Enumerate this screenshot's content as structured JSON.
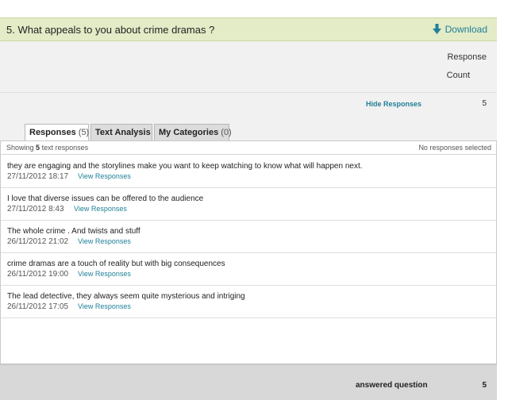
{
  "question": {
    "title": "5. What appeals to you about crime dramas ?",
    "download_label": "Download"
  },
  "response_count_header": {
    "line1": "Response",
    "line2": "Count"
  },
  "hide_responses": {
    "label": "Hide Responses",
    "count": "5"
  },
  "tabs": [
    {
      "label": "Responses",
      "count": "(5)",
      "active": true
    },
    {
      "label": "Text Analysis",
      "count": "",
      "active": false
    },
    {
      "label": "My Categories",
      "count": "(0)",
      "active": false
    }
  ],
  "toolbar": {
    "showing_prefix": "Showing",
    "showing_count": "5",
    "showing_suffix": "text responses",
    "selection_status": "No responses selected"
  },
  "responses": [
    {
      "text": "they are engaging and the storylines make you want to keep watching to know what will happen next.",
      "date": "27/11/2012 18:17",
      "link": "View Responses"
    },
    {
      "text": "I love that diverse issues can be offered to the audience",
      "date": "27/11/2012 8:43",
      "link": "View Responses"
    },
    {
      "text": "The whole crime . And twists and stuff",
      "date": "26/11/2012 21:02",
      "link": "View Responses"
    },
    {
      "text": "crime dramas are a touch of reality but with big consequences",
      "date": "26/11/2012 19:00",
      "link": "View Responses"
    },
    {
      "text": "The lead detective, they always seem quite mysterious and intriging",
      "date": "26/11/2012 17:05",
      "link": "View Responses"
    }
  ],
  "footer": {
    "answered_label": "answered question",
    "answered_count": "5"
  },
  "colors": {
    "header_bg": "#e3ebc7",
    "link": "#1f7f98",
    "panel_bg": "#f1f1f1",
    "footer_bg": "#d8d8d8"
  }
}
